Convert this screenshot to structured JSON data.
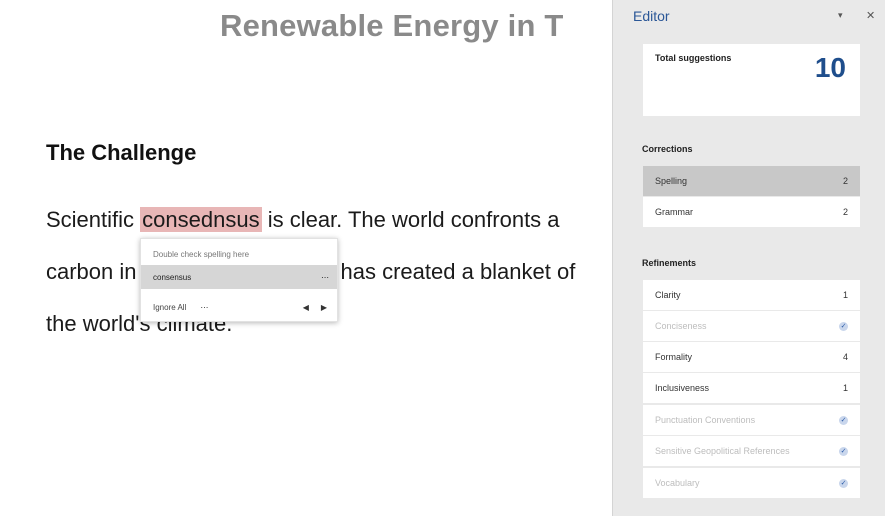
{
  "document": {
    "title": "Renewable Energy in T",
    "heading": "The Challenge",
    "line1": {
      "before": "Scientific ",
      "misspelled": "consednsus",
      "after": " is clear. The world confronts a"
    },
    "line2": {
      "before": "carbon in",
      "after": "has created a blanket of"
    },
    "line3": "the world's climate."
  },
  "spelling_popup": {
    "header": "Double check spelling here",
    "suggestion": "consensus",
    "suggestion_more": "⋯",
    "ignore_all": "Ignore All",
    "more": "⋯",
    "prev": "◀",
    "next": "▶"
  },
  "editor": {
    "title": "Editor",
    "minimize_icon": "▾",
    "close_icon": "✕",
    "total_label": "Total suggestions",
    "total_value": "10",
    "corrections_label": "Corrections",
    "corrections": [
      {
        "label": "Spelling",
        "count": "2",
        "selected": true
      },
      {
        "label": "Grammar",
        "count": "2"
      }
    ],
    "refinements_label": "Refinements",
    "refinements": [
      {
        "label": "Clarity",
        "count": "1"
      },
      {
        "label": "Conciseness",
        "done": true
      },
      {
        "label": "Formality",
        "count": "4"
      },
      {
        "label": "Inclusiveness",
        "count": "1"
      },
      {
        "label": "Punctuation Conventions",
        "done": true
      },
      {
        "label": "Sensitive Geopolitical References",
        "done": true
      },
      {
        "label": "Vocabulary",
        "done": true
      }
    ],
    "check_glyph": "✓",
    "accent_color": "#1f4e8c"
  }
}
